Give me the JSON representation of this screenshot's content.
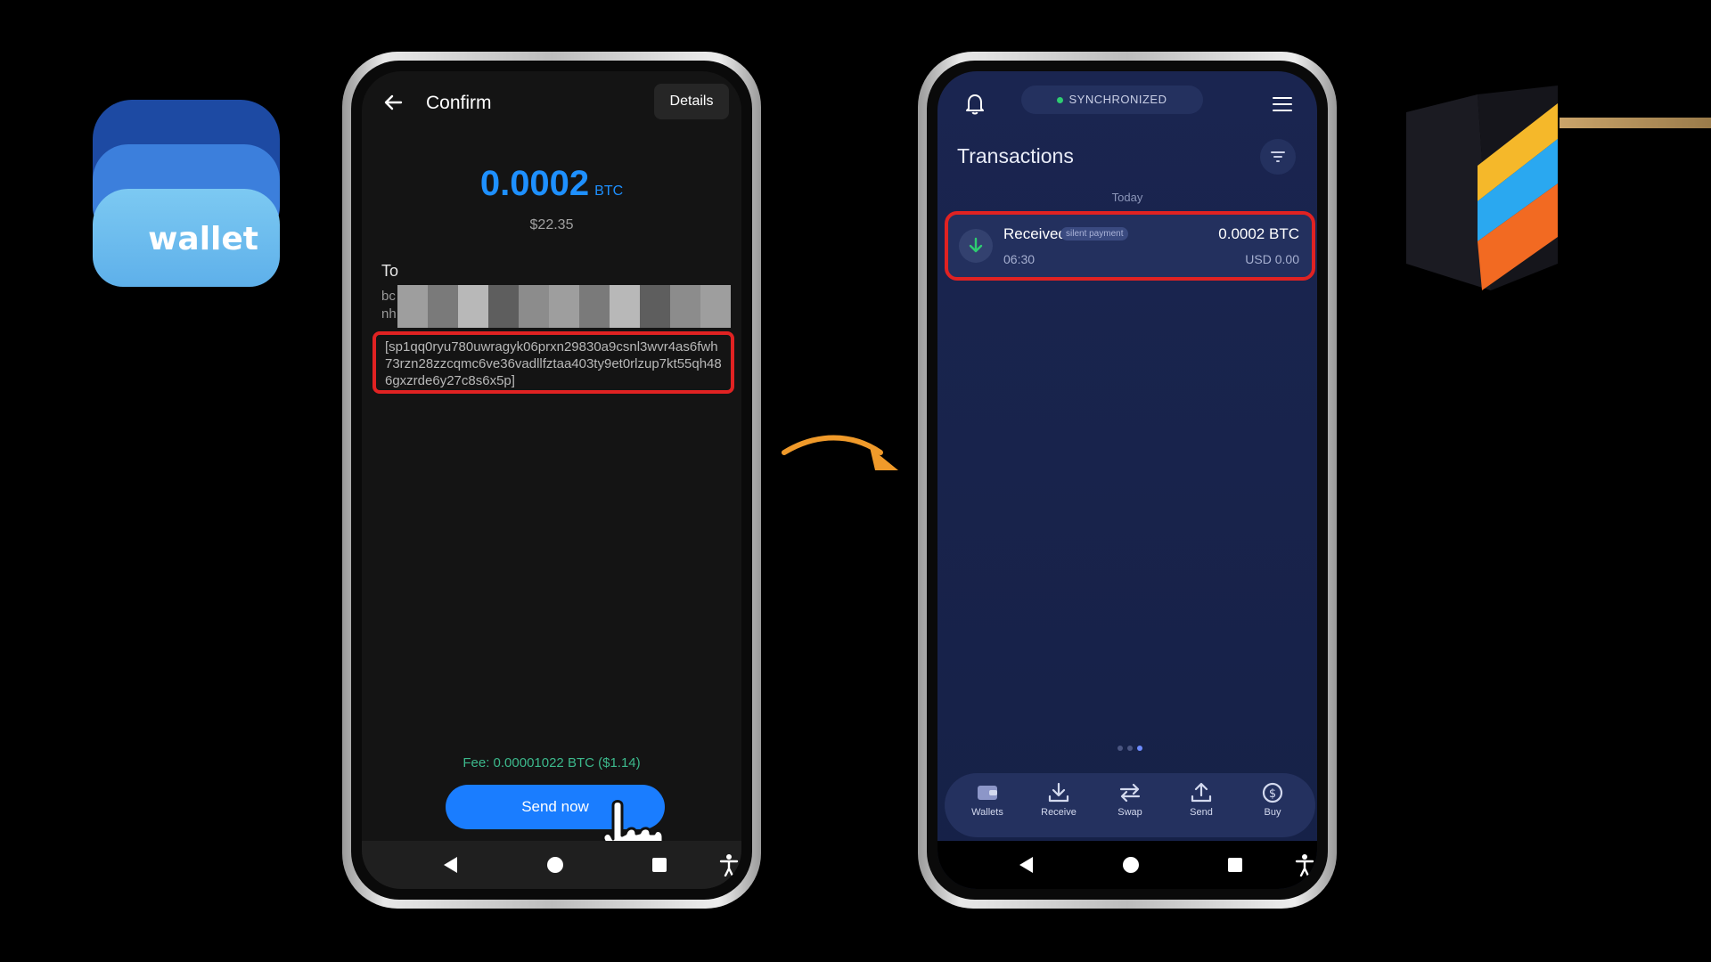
{
  "left_logo": {
    "text": "wallet"
  },
  "left_phone": {
    "title": "Confirm",
    "details_label": "Details",
    "amount": "0.0002",
    "amount_unit": "BTC",
    "fiat": "$22.35",
    "to_label": "To",
    "address_line1_prefix": "bc",
    "address_line1_suffix": "vn",
    "address_line2_prefix": "nh",
    "silent_payment_address": "[sp1qq0ryu780uwragyk06prxn29830a9csnl3wvr4as6fwh73rzn28zzcqmc6ve36vadllfztaa403ty9et0rlzup7kt55qh486gxzrde6y27c8s6x5p]",
    "fee": "Fee: 0.00001022 BTC ($1.14)",
    "send_label": "Send now"
  },
  "right_phone": {
    "sync_status": "SYNCHRONIZED",
    "transactions_title": "Transactions",
    "day_label": "Today",
    "transaction": {
      "status": "Received",
      "tag": "silent payment",
      "amount": "0.0002 BTC",
      "time": "06:30",
      "fiat": "USD 0.00"
    },
    "bottom_nav": [
      {
        "label": "Wallets",
        "icon": "wallet-icon"
      },
      {
        "label": "Receive",
        "icon": "download-icon"
      },
      {
        "label": "Swap",
        "icon": "swap-arrows-icon"
      },
      {
        "label": "Send",
        "icon": "upload-icon"
      },
      {
        "label": "Buy",
        "icon": "dollar-circle-icon"
      }
    ]
  },
  "colors": {
    "accent_blue": "#1a7dff",
    "highlight_red": "#e02222",
    "fee_green": "#3cb98c",
    "arrow_orange": "#f09a2a"
  }
}
